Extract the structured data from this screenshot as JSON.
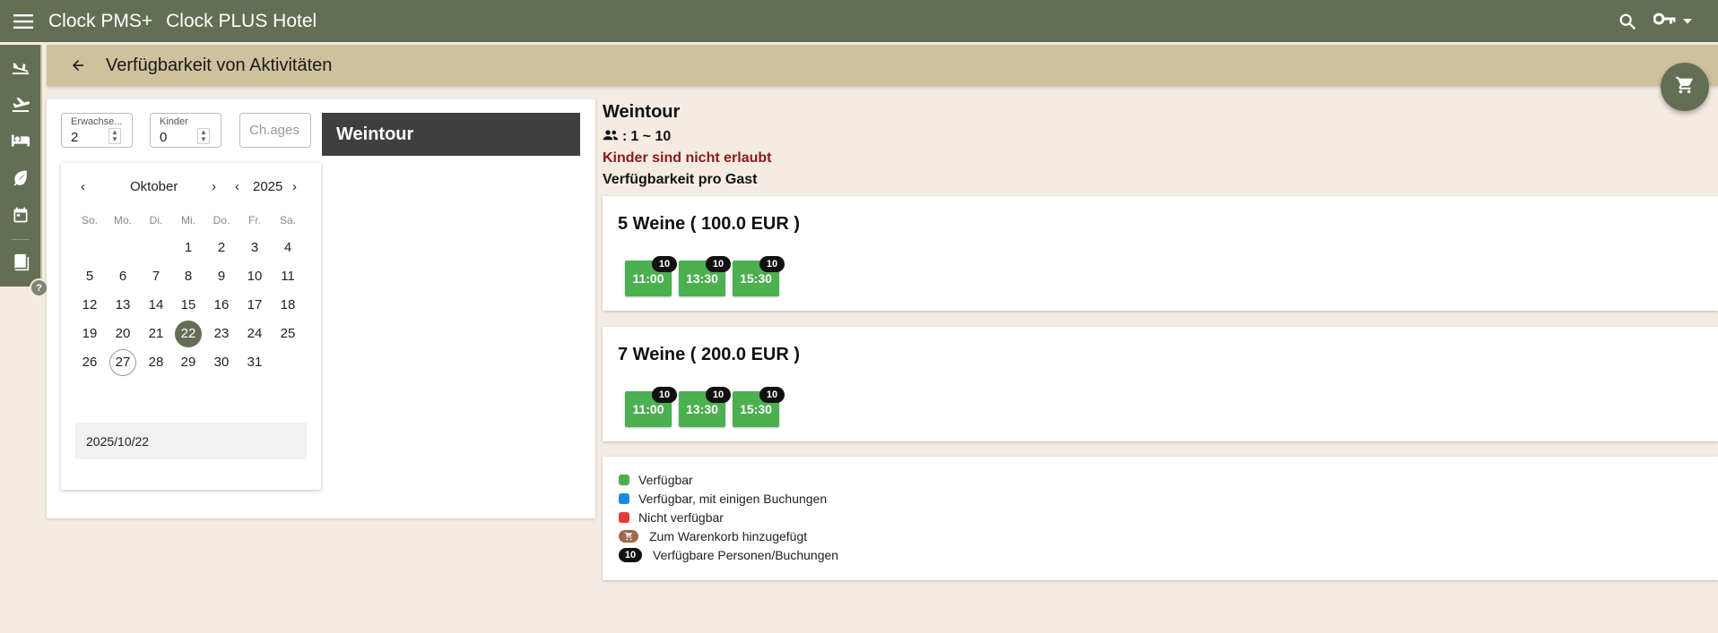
{
  "topbar": {
    "app_name": "Clock PMS+",
    "hotel_name": "Clock PLUS Hotel",
    "icons": [
      "menu-icon",
      "search-icon",
      "key-icon",
      "arrow-drop-down-icon"
    ]
  },
  "sidebar": {
    "icons": [
      "flight-land-icon",
      "flight-takeoff-icon",
      "bed-icon",
      "leaf-icon",
      "calendar-icon",
      "book-icon"
    ],
    "help_label": "?"
  },
  "page": {
    "title": "Verfügbarkeit von Aktivitäten"
  },
  "form": {
    "adults_label": "Erwachse...",
    "adults_value": "2",
    "children_label": "Kinder",
    "children_value": "0",
    "child_ages_placeholder": "Ch.ages"
  },
  "activity_header": "Weintour",
  "calendar": {
    "month": "Oktober",
    "year": "2025",
    "weekdays": [
      "So.",
      "Mo.",
      "Di.",
      "Mi.",
      "Do.",
      "Fr.",
      "Sa."
    ],
    "first_weekday_index": 3,
    "days_in_month": 31,
    "selected_day": 22,
    "today_day": 27,
    "date_value": "2025/10/22"
  },
  "info": {
    "title": "Weintour",
    "capacity": "1 ~ 10",
    "capacity_prefix": ":",
    "children_warning": "Kinder sind nicht erlaubt",
    "per_guest": "Verfügbarkeit pro Gast"
  },
  "options": [
    {
      "title": "5 Weine ( 100.0 EUR )",
      "slots": [
        {
          "time": "11:00",
          "available": "10"
        },
        {
          "time": "13:30",
          "available": "10"
        },
        {
          "time": "15:30",
          "available": "10"
        }
      ]
    },
    {
      "title": "7 Weine ( 200.0 EUR )",
      "slots": [
        {
          "time": "11:00",
          "available": "10"
        },
        {
          "time": "13:30",
          "available": "10"
        },
        {
          "time": "15:30",
          "available": "10"
        }
      ]
    }
  ],
  "legend": {
    "available": "Verfügbar",
    "available_some": "Verfügbar, mit einigen Buchungen",
    "not_available": "Nicht verfügbar",
    "in_cart": "Zum Warenkorb hinzugefügt",
    "count_badge": "10",
    "available_persons": "Verfügbare Personen/Buchungen"
  },
  "colors": {
    "primary": "#636e55",
    "header_bg": "#cfc09e",
    "page_bg": "#f4ebe2",
    "available": "#4caf50",
    "available_some": "#1e88e5",
    "not_available": "#e53935",
    "in_cart": "#a1674b",
    "warning_text": "#8b1a1a"
  }
}
